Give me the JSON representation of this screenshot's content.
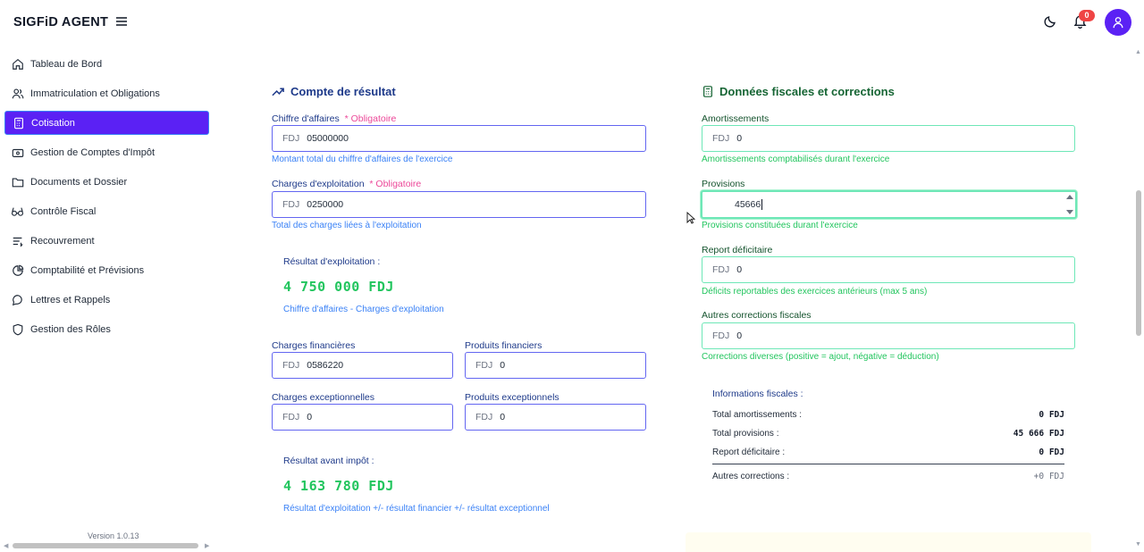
{
  "header": {
    "brand": "SIGFiD AGENT",
    "notification_count": "0",
    "icons": [
      "menu-icon",
      "moon-icon",
      "bell-icon",
      "user-icon"
    ],
    "colors": {
      "accent": "#5b21f4",
      "badge": "#ef4444"
    }
  },
  "sidebar": {
    "items": [
      {
        "label": "Tableau de Bord",
        "icon": "home-icon"
      },
      {
        "label": "Immatriculation et Obligations",
        "icon": "users-icon"
      },
      {
        "label": "Cotisation",
        "icon": "calculator-icon",
        "active": true
      },
      {
        "label": "Gestion de Comptes d'Impôt",
        "icon": "wallet-icon"
      },
      {
        "label": "Documents et Dossier",
        "icon": "folder-icon"
      },
      {
        "label": "Contrôle Fiscal",
        "icon": "glasses-icon"
      },
      {
        "label": "Recouvrement",
        "icon": "list-icon"
      },
      {
        "label": "Comptabilité et Prévisions",
        "icon": "pie-chart-icon"
      },
      {
        "label": "Lettres et Rappels",
        "icon": "message-icon"
      },
      {
        "label": "Gestion des Rôles",
        "icon": "shield-icon"
      }
    ],
    "version": "Version 1.0.13"
  },
  "compte": {
    "title": "Compte de résultat",
    "required_label": "* Obligatoire",
    "currency": "FDJ",
    "ca": {
      "label": "Chiffre d'affaires",
      "value": "05000000",
      "hint": "Montant total du chiffre d'affaires de l'exercice"
    },
    "charges_exp": {
      "label": "Charges d'exploitation",
      "value": "0250000",
      "hint": "Total des charges liées à l'exploitation"
    },
    "resultat_exp": {
      "title": "Résultat d'exploitation :",
      "value": "4 750 000 FDJ",
      "hint": "Chiffre d'affaires - Charges d'exploitation"
    },
    "charges_fin": {
      "label": "Charges financières",
      "value": "0586220"
    },
    "produits_fin": {
      "label": "Produits financiers",
      "value": "0"
    },
    "charges_exc": {
      "label": "Charges exceptionnelles",
      "value": "0"
    },
    "produits_exc": {
      "label": "Produits exceptionnels",
      "value": "0"
    },
    "resultat_avant": {
      "title": "Résultat avant impôt :",
      "value": "4 163 780 FDJ",
      "hint": "Résultat d'exploitation +/- résultat financier +/- résultat exceptionnel"
    }
  },
  "fiscal": {
    "title": "Données fiscales et corrections",
    "currency": "FDJ",
    "amortissements": {
      "label": "Amortissements",
      "value": "0",
      "hint": "Amortissements comptabilisés durant l'exercice"
    },
    "provisions": {
      "label": "Provisions",
      "value": "45666",
      "hint": "Provisions constituées durant l'exercice"
    },
    "report": {
      "label": "Report déficitaire",
      "value": "0",
      "hint": "Déficits reportables des exercices antérieurs (max 5 ans)"
    },
    "autres": {
      "label": "Autres corrections fiscales",
      "value": "0",
      "hint": "Corrections diverses (positive = ajout, négative = déduction)"
    },
    "info": {
      "title": "Informations fiscales :",
      "rows": [
        {
          "label": "Total amortissements :",
          "value": "0 FDJ"
        },
        {
          "label": "Total provisions :",
          "value": "45 666 FDJ"
        },
        {
          "label": "Report déficitaire :",
          "value": "0 FDJ"
        },
        {
          "label": "Autres corrections :",
          "value": "+0 FDJ"
        }
      ]
    }
  }
}
